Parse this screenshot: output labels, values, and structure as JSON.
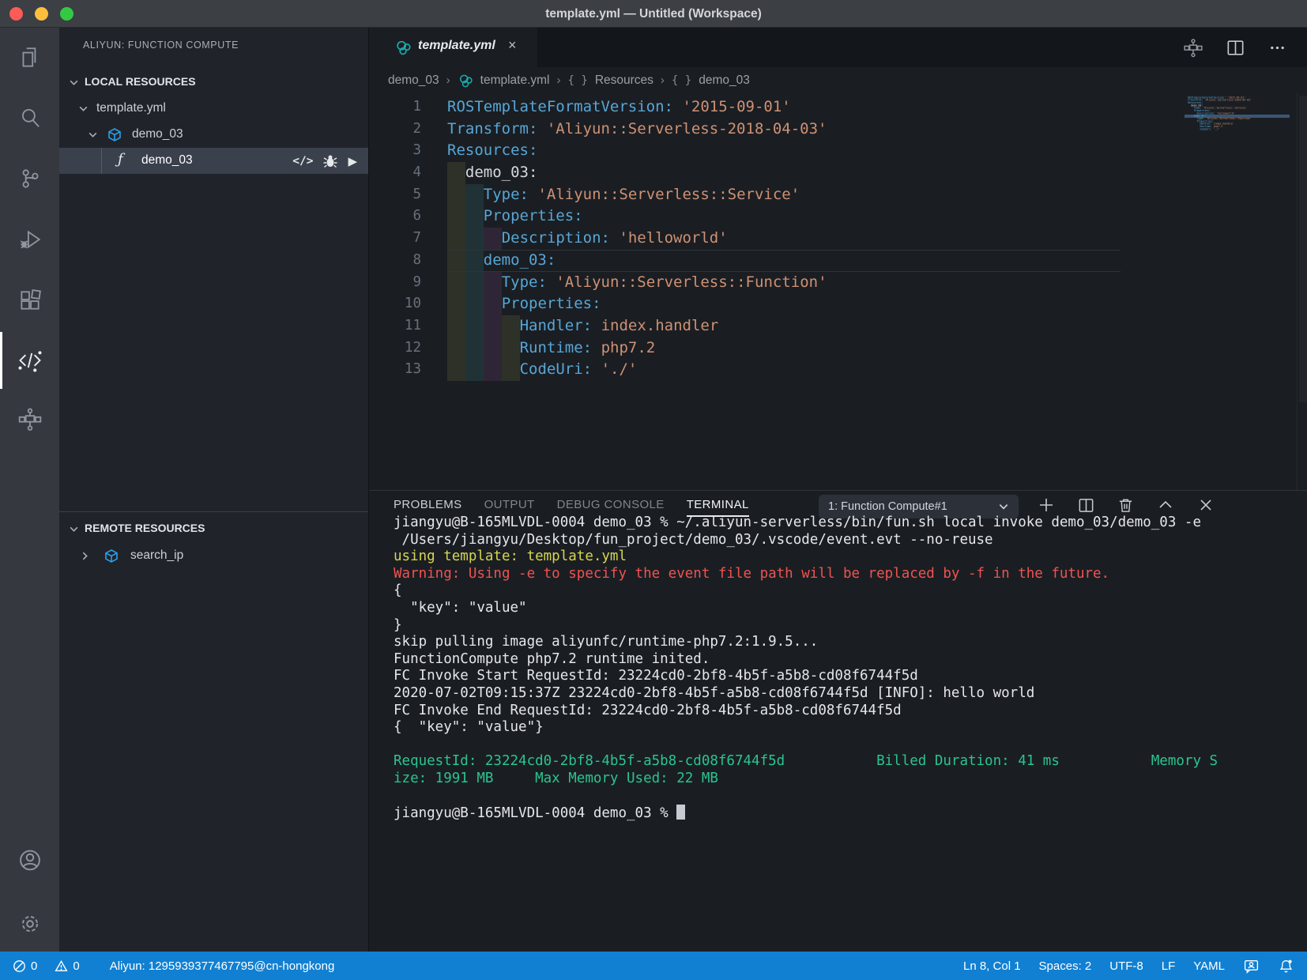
{
  "colors": {
    "statusbar_bg": "#1180d2",
    "editor_bg": "#1a1e23",
    "sidebar_bg": "#20242a",
    "activitybar_bg": "#35393f",
    "titlebar_bg": "#3c3f44",
    "selected_row_bg": "#3a414c",
    "key_token": "#58a6d6",
    "string_token": "#cf9173",
    "terminal_green": "#2bc48e",
    "terminal_yellow": "#d6d551",
    "terminal_red": "#ef5350",
    "traffic_close": "#fc5b57",
    "traffic_minimize": "#fdbe3f",
    "traffic_zoom": "#34c943",
    "ros_icon_teal": "#1aabad",
    "cube_icon_blue": "#2ba0e8"
  },
  "window": {
    "title": "template.yml — Untitled (Workspace)"
  },
  "activity_bar": {
    "items": [
      "explorer-icon",
      "search-icon",
      "source-control-icon",
      "run-and-debug-icon",
      "extensions-icon",
      "aliyun-function-compute-icon",
      "aliyun-deploy-icon"
    ],
    "active": "aliyun-function-compute-icon",
    "bottom_items": [
      "accounts-icon",
      "settings-gear-icon"
    ]
  },
  "sidebar": {
    "pane_title": "ALIYUN: FUNCTION COMPUTE",
    "sections": [
      {
        "label": "LOCAL RESOURCES",
        "items": [
          {
            "label": "template.yml"
          },
          {
            "label": "demo_03",
            "icon": "service-cube"
          },
          {
            "label": "demo_03",
            "icon": "function",
            "selected": true,
            "actions": {
              "code_glyph": "</>",
              "bug": "bug-icon",
              "play_glyph": "▶"
            }
          }
        ]
      },
      {
        "label": "REMOTE RESOURCES",
        "items": [
          {
            "label": "search_ip",
            "icon": "service-cube"
          }
        ]
      }
    ],
    "function_glyph": "ƒ"
  },
  "editor": {
    "tab": {
      "label": "template.yml",
      "close_glyph": "×"
    },
    "breadcrumbs": {
      "separator_glyph": "›",
      "braces_glyph": "{ }",
      "crumbs": [
        {
          "label": "demo_03",
          "icon": "none"
        },
        {
          "label": "template.yml",
          "icon": "ros"
        },
        {
          "label": "Resources",
          "icon": "braces"
        },
        {
          "label": "demo_03",
          "icon": "braces"
        }
      ]
    },
    "lines": [
      {
        "n": 1,
        "indent": 0,
        "tokens": [
          [
            "ROSTemplateFormatVersion:",
            "key"
          ],
          [
            " ",
            "plain"
          ],
          [
            "'2015-09-01'",
            "str"
          ]
        ]
      },
      {
        "n": 2,
        "indent": 0,
        "tokens": [
          [
            "Transform:",
            "key"
          ],
          [
            " ",
            "plain"
          ],
          [
            "'Aliyun::Serverless-2018-04-03'",
            "str"
          ]
        ]
      },
      {
        "n": 3,
        "indent": 0,
        "tokens": [
          [
            "Resources:",
            "key"
          ]
        ]
      },
      {
        "n": 4,
        "indent": 2,
        "tokens": [
          [
            "demo_03:",
            "plain"
          ]
        ]
      },
      {
        "n": 5,
        "indent": 4,
        "tokens": [
          [
            "Type:",
            "key"
          ],
          [
            " ",
            "plain"
          ],
          [
            "'Aliyun::Serverless::Service'",
            "str"
          ]
        ]
      },
      {
        "n": 6,
        "indent": 4,
        "tokens": [
          [
            "Properties:",
            "key"
          ]
        ]
      },
      {
        "n": 7,
        "indent": 6,
        "tokens": [
          [
            "Description:",
            "key"
          ],
          [
            " ",
            "plain"
          ],
          [
            "'helloworld'",
            "str"
          ]
        ]
      },
      {
        "n": 8,
        "indent": 4,
        "tokens": [
          [
            "demo_03:",
            "key"
          ]
        ],
        "current": true
      },
      {
        "n": 9,
        "indent": 6,
        "tokens": [
          [
            "Type:",
            "key"
          ],
          [
            " ",
            "plain"
          ],
          [
            "'Aliyun::Serverless::Function'",
            "str"
          ]
        ]
      },
      {
        "n": 10,
        "indent": 6,
        "tokens": [
          [
            "Properties:",
            "key"
          ]
        ]
      },
      {
        "n": 11,
        "indent": 8,
        "tokens": [
          [
            "Handler:",
            "key"
          ],
          [
            " ",
            "plain"
          ],
          [
            "index.handler",
            "str"
          ]
        ]
      },
      {
        "n": 12,
        "indent": 8,
        "tokens": [
          [
            "Runtime:",
            "key"
          ],
          [
            " ",
            "plain"
          ],
          [
            "php7.2",
            "str"
          ]
        ]
      },
      {
        "n": 13,
        "indent": 8,
        "tokens": [
          [
            "CodeUri:",
            "key"
          ],
          [
            " ",
            "plain"
          ],
          [
            "'./'",
            "str"
          ]
        ]
      }
    ]
  },
  "panel": {
    "tabs": [
      {
        "label": "PROBLEMS",
        "state": "bright"
      },
      {
        "label": "OUTPUT",
        "state": "dim"
      },
      {
        "label": "DEBUG CONSOLE",
        "state": "dim"
      },
      {
        "label": "TERMINAL",
        "state": "active"
      }
    ],
    "terminal_selector": "1: Function Compute#1",
    "action_icons": [
      "new-terminal-icon",
      "split-terminal-icon",
      "kill-terminal-icon",
      "maximize-panel-icon",
      "close-panel-icon"
    ]
  },
  "terminal": {
    "lines": [
      {
        "text": "jiangyu@B-165MLVDL-0004 demo_03 % ~/.aliyun-serverless/bin/fun.sh local invoke demo_03/demo_03 -e",
        "color": "default"
      },
      {
        "text": " /Users/jiangyu/Desktop/fun_project/demo_03/.vscode/event.evt --no-reuse",
        "color": "default"
      },
      {
        "text": "using template: template.yml",
        "color": "yellow"
      },
      {
        "text": "Warning: Using -e to specify the event file path will be replaced by -f in the future.",
        "color": "red"
      },
      {
        "text": "{",
        "color": "default"
      },
      {
        "text": "  \"key\": \"value\"",
        "color": "default"
      },
      {
        "text": "}",
        "color": "default"
      },
      {
        "text": "skip pulling image aliyunfc/runtime-php7.2:1.9.5...",
        "color": "default"
      },
      {
        "text": "FunctionCompute php7.2 runtime inited.",
        "color": "default"
      },
      {
        "text": "FC Invoke Start RequestId: 23224cd0-2bf8-4b5f-a5b8-cd08f6744f5d",
        "color": "default"
      },
      {
        "text": "2020-07-02T09:15:37Z 23224cd0-2bf8-4b5f-a5b8-cd08f6744f5d [INFO]: hello world",
        "color": "default"
      },
      {
        "text": "FC Invoke End RequestId: 23224cd0-2bf8-4b5f-a5b8-cd08f6744f5d",
        "color": "default"
      },
      {
        "text": "{  \"key\": \"value\"}",
        "color": "default"
      },
      {
        "text": "",
        "color": "default"
      },
      {
        "text": "RequestId: 23224cd0-2bf8-4b5f-a5b8-cd08f6744f5d           Billed Duration: 41 ms           Memory S",
        "color": "green"
      },
      {
        "text": "ize: 1991 MB     Max Memory Used: 22 MB",
        "color": "green"
      },
      {
        "text": "",
        "color": "default"
      },
      {
        "text": "jiangyu@B-165MLVDL-0004 demo_03 % ",
        "color": "default",
        "cursor": true
      }
    ]
  },
  "status_bar": {
    "errors": "0",
    "warnings": "0",
    "aliyun_account": "Aliyun: 1295939377467795@cn-hongkong",
    "cursor_position": "Ln 8, Col 1",
    "indentation": "Spaces: 2",
    "encoding": "UTF-8",
    "eol": "LF",
    "language": "YAML"
  }
}
